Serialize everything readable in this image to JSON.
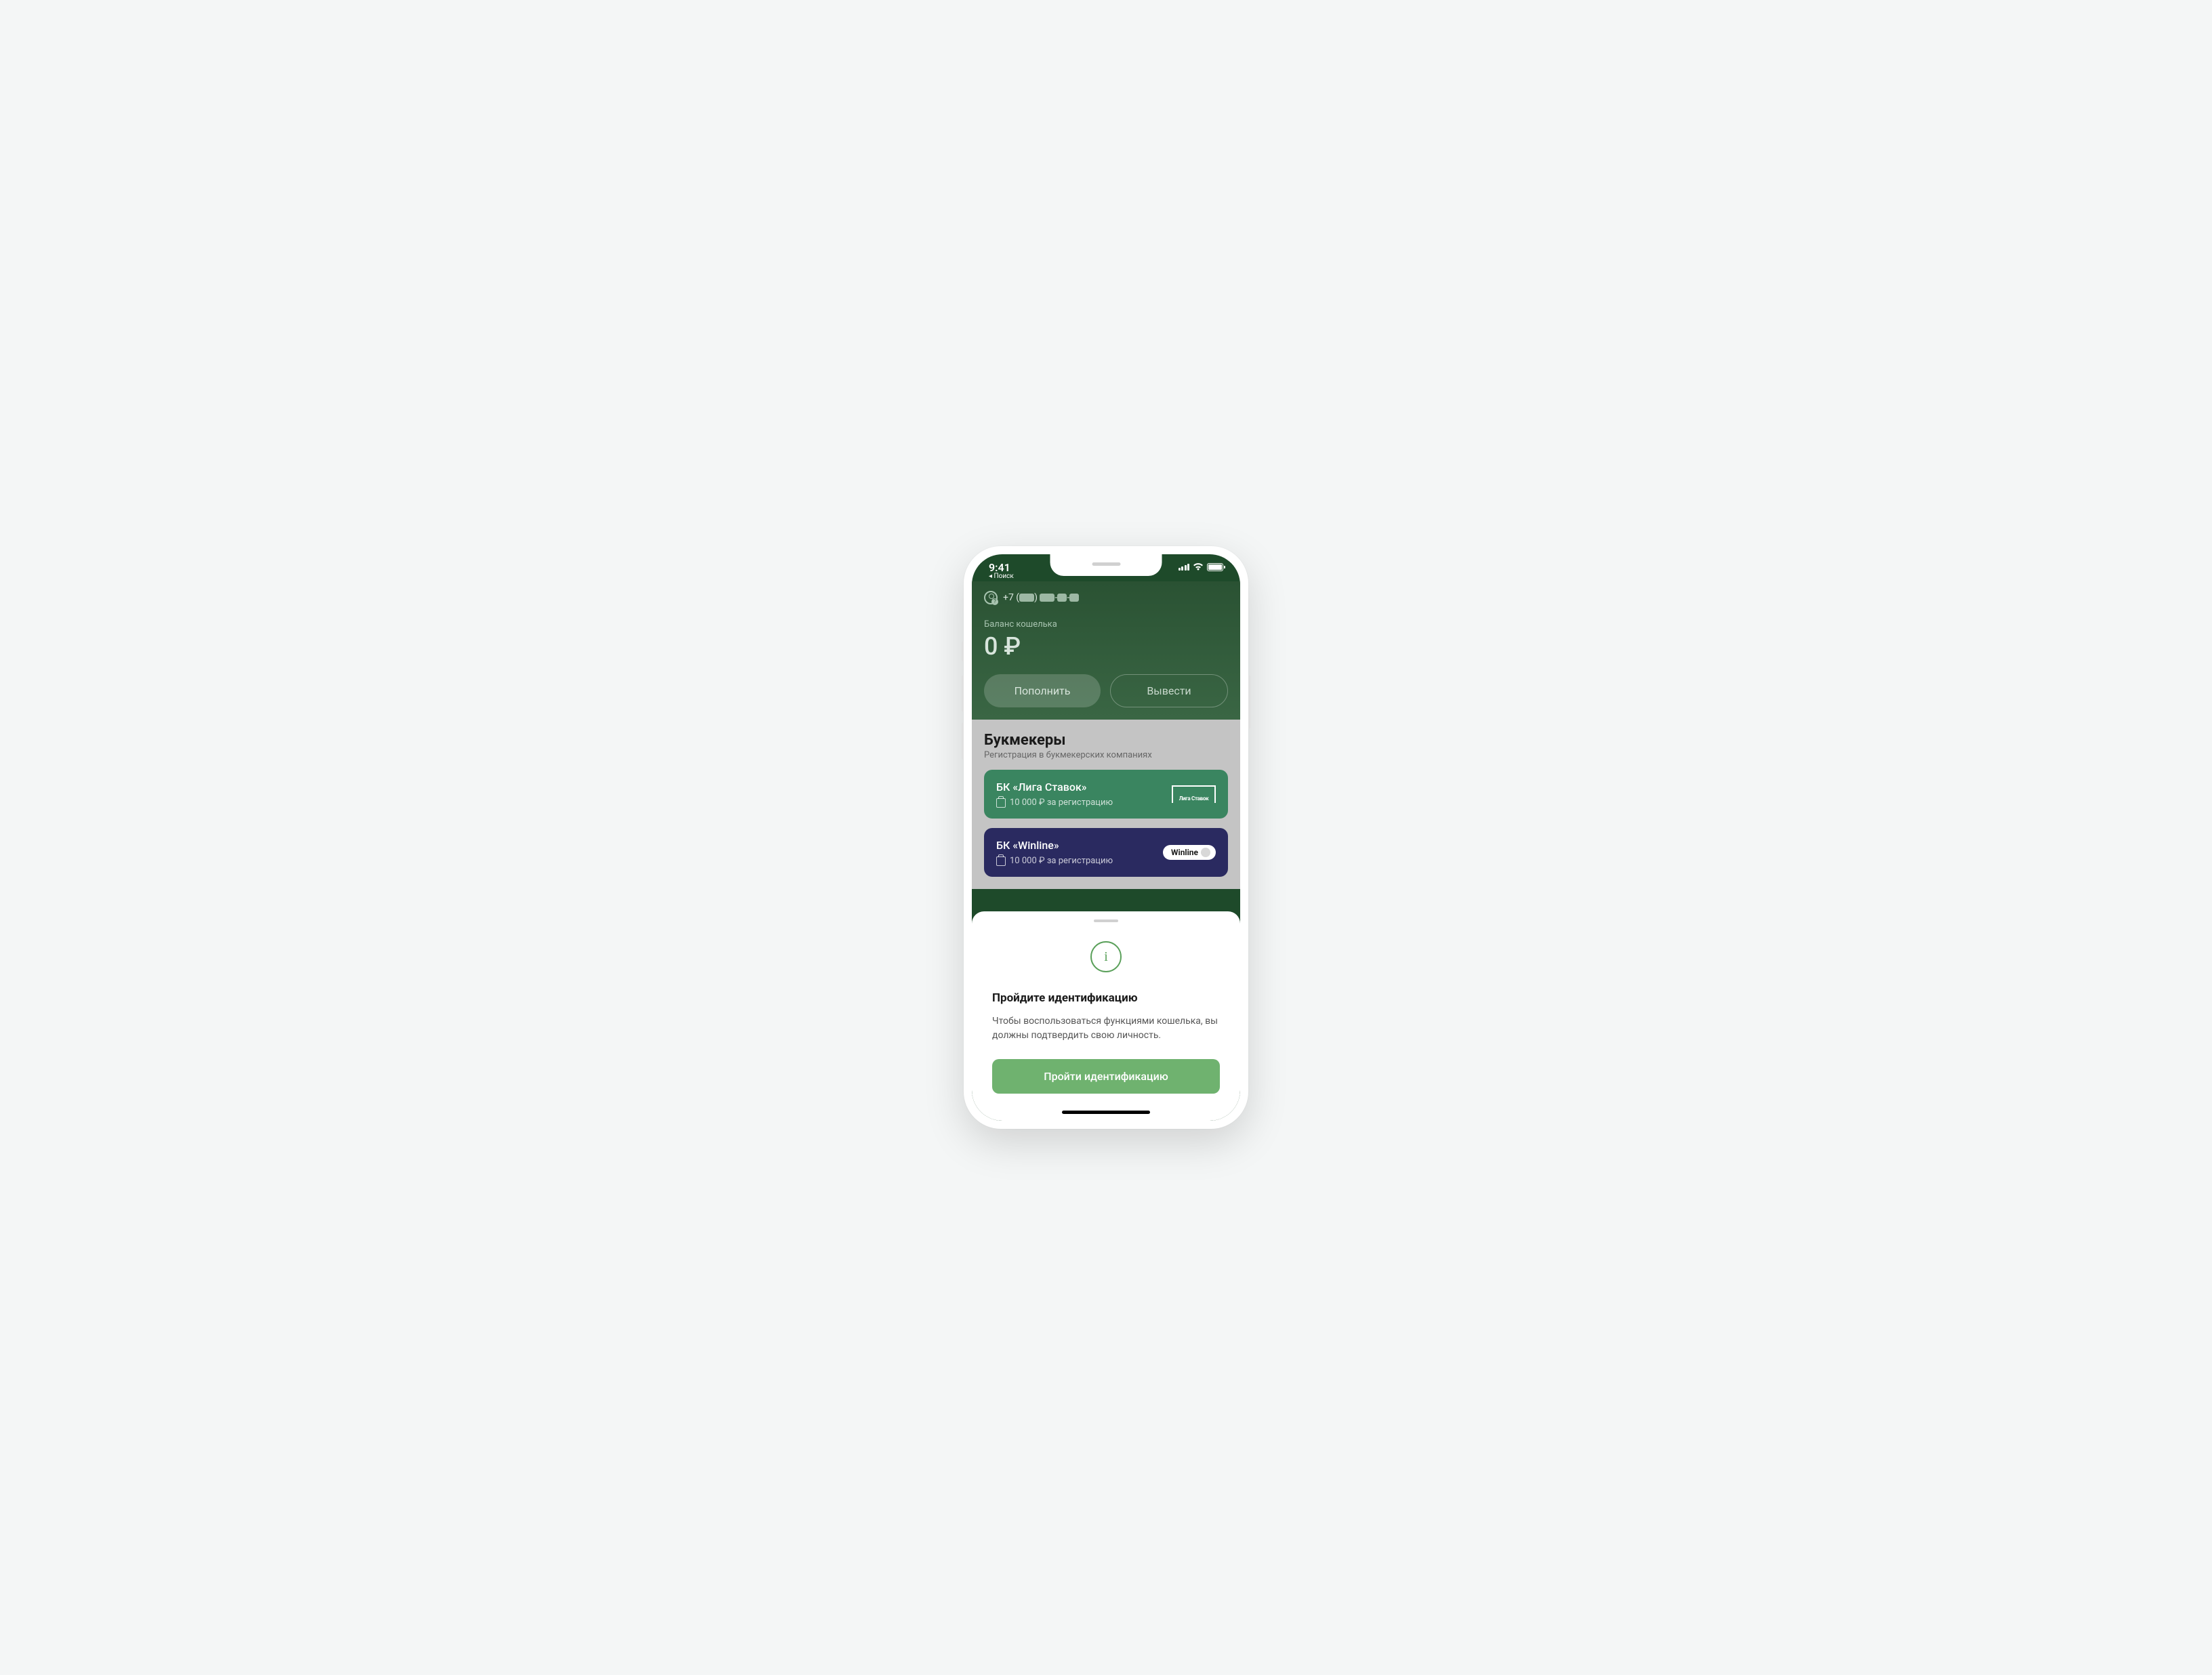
{
  "status": {
    "time": "9:41",
    "back_label": "◂ Поиск"
  },
  "header": {
    "phone_prefix": "+7 (",
    "phone_close": ") ",
    "balance_label": "Баланс кошелька",
    "balance_value": "0 ₽",
    "deposit_label": "Пополнить",
    "withdraw_label": "Вывести"
  },
  "bookmakers": {
    "title": "Букмекеры",
    "subtitle": "Регистрация в букмекерских компаниях",
    "cards": [
      {
        "name": "БК «Лига Ставок»",
        "bonus": "10 000 ₽ за регистрацию",
        "logo": "Лига Ставок"
      },
      {
        "name": "БК «Winline»",
        "bonus": "10 000 ₽ за регистрацию",
        "logo": "Winline"
      }
    ]
  },
  "sheet": {
    "title": "Пройдите идентификацию",
    "body": "Чтобы воспользоваться функциями кошелька, вы должны подтвердить свою личность.",
    "button": "Пройти идентификацию"
  }
}
